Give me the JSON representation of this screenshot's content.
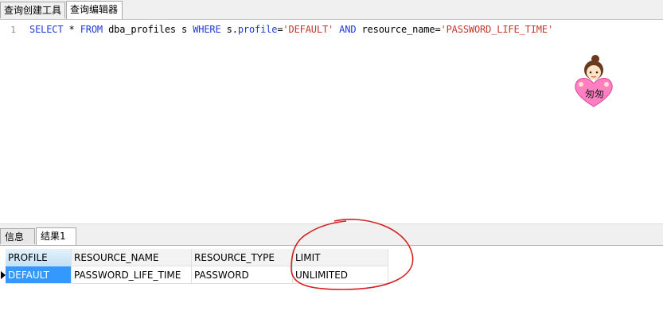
{
  "top_tabs": [
    {
      "label": "查询创建工具",
      "active": false
    },
    {
      "label": "查询编辑器",
      "active": true
    }
  ],
  "editor": {
    "line_number": "1",
    "sql_tokens": [
      {
        "t": "SELECT",
        "type": "kw"
      },
      {
        "t": " * ",
        "type": "plain"
      },
      {
        "t": "FROM",
        "type": "kw"
      },
      {
        "t": " dba_profiles s ",
        "type": "plain"
      },
      {
        "t": "WHERE",
        "type": "kw"
      },
      {
        "t": " s.",
        "type": "plain"
      },
      {
        "t": "profile",
        "type": "kw"
      },
      {
        "t": "=",
        "type": "plain"
      },
      {
        "t": "'DEFAULT'",
        "type": "str"
      },
      {
        "t": " ",
        "type": "plain"
      },
      {
        "t": "AND",
        "type": "kw"
      },
      {
        "t": " resource_name=",
        "type": "plain"
      },
      {
        "t": "'PASSWORD_LIFE_TIME'",
        "type": "str"
      }
    ],
    "mascot_text": "匆匆"
  },
  "bottom_tabs": [
    {
      "label": "信息",
      "active": false
    },
    {
      "label": "结果1",
      "active": true
    }
  ],
  "result_grid": {
    "columns": [
      "PROFILE",
      "RESOURCE_NAME",
      "RESOURCE_TYPE",
      "LIMIT"
    ],
    "rows": [
      [
        "DEFAULT",
        "PASSWORD_LIFE_TIME",
        "PASSWORD",
        "UNLIMITED"
      ]
    ]
  },
  "colors": {
    "keyword": "#1f3bd6",
    "string": "#c0392b",
    "selection": "#3399ff",
    "annotation": "#d62020"
  }
}
